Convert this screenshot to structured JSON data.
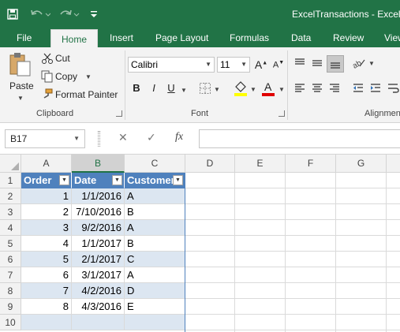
{
  "window": {
    "title": "ExcelTransactions - Excel"
  },
  "qat": {
    "save_icon": "save-icon",
    "undo_icon": "undo-icon",
    "redo_icon": "redo-icon",
    "customize_icon": "qat-customize-icon"
  },
  "tabs": [
    {
      "label": "File"
    },
    {
      "label": "Home"
    },
    {
      "label": "Insert"
    },
    {
      "label": "Page Layout"
    },
    {
      "label": "Formulas"
    },
    {
      "label": "Data"
    },
    {
      "label": "Review"
    },
    {
      "label": "View"
    }
  ],
  "ribbon": {
    "clipboard": {
      "paste": "Paste",
      "cut": "Cut",
      "copy": "Copy",
      "format_painter": "Format Painter",
      "label": "Clipboard"
    },
    "font": {
      "family": "Calibri",
      "size": "11",
      "bold": "B",
      "italic": "I",
      "underline": "U",
      "font_color_glyph": "A",
      "label": "Font"
    },
    "alignment": {
      "label": "Alignment"
    }
  },
  "formula_bar": {
    "name_box": "B17",
    "cancel": "✕",
    "enter": "✓",
    "fx": "fx",
    "value": ""
  },
  "sheet": {
    "columns": [
      "A",
      "B",
      "C",
      "D",
      "E",
      "F",
      "G"
    ],
    "selected_column": "B",
    "rows": [
      "1",
      "2",
      "3",
      "4",
      "5",
      "6",
      "7",
      "8",
      "9",
      "10"
    ],
    "headers": [
      "Order",
      "Date",
      "Customer"
    ],
    "data": [
      {
        "order": "1",
        "date": "1/1/2016",
        "customer": "A"
      },
      {
        "order": "2",
        "date": "7/10/2016",
        "customer": "B"
      },
      {
        "order": "3",
        "date": "9/2/2016",
        "customer": "A"
      },
      {
        "order": "4",
        "date": "1/1/2017",
        "customer": "B"
      },
      {
        "order": "5",
        "date": "2/1/2017",
        "customer": "C"
      },
      {
        "order": "6",
        "date": "3/1/2017",
        "customer": "A"
      },
      {
        "order": "7",
        "date": "4/2/2016",
        "customer": "D"
      },
      {
        "order": "8",
        "date": "4/3/2016",
        "customer": "E"
      }
    ]
  },
  "colors": {
    "accent": "#217346",
    "table_header": "#4f81bd",
    "table_band": "#dce6f1"
  }
}
